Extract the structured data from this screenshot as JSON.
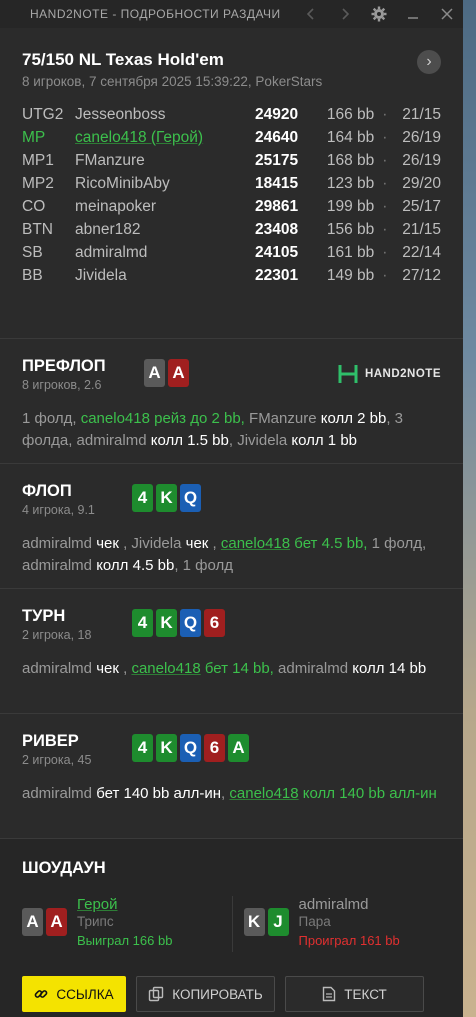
{
  "window": {
    "title": "HAND2NOTE - ПОДРОБНОСТИ РАЗДАЧИ"
  },
  "game": {
    "title": "75/150 NL Texas Hold'em",
    "subtitle": "8 игроков, 7 сентября 2025 15:39:22, PokerStars"
  },
  "players": [
    {
      "pos": "UTG2",
      "name": "Jesseonboss",
      "stack": "24920",
      "bb": "166 bb",
      "sep": "·",
      "stats": "21/15",
      "hero": false
    },
    {
      "pos": "MP",
      "name": "canelo418 (Герой)",
      "stack": "24640",
      "bb": "164 bb",
      "sep": "·",
      "stats": "26/19",
      "hero": true
    },
    {
      "pos": "MP1",
      "name": "FManzure",
      "stack": "25175",
      "bb": "168 bb",
      "sep": "·",
      "stats": "26/19",
      "hero": false
    },
    {
      "pos": "MP2",
      "name": "RicoMinibAby",
      "stack": "18415",
      "bb": "123 bb",
      "sep": "·",
      "stats": "29/20",
      "hero": false
    },
    {
      "pos": "CO",
      "name": "meinapoker",
      "stack": "29861",
      "bb": "199 bb",
      "sep": "·",
      "stats": "25/17",
      "hero": false
    },
    {
      "pos": "BTN",
      "name": "abner182",
      "stack": "23408",
      "bb": "156 bb",
      "sep": "·",
      "stats": "21/15",
      "hero": false
    },
    {
      "pos": "SB",
      "name": "admiralmd",
      "stack": "24105",
      "bb": "161 bb",
      "sep": "·",
      "stats": "22/14",
      "hero": false
    },
    {
      "pos": "BB",
      "name": "Jividela",
      "stack": "22301",
      "bb": "149 bb",
      "sep": "·",
      "stats": "27/12",
      "hero": false
    }
  ],
  "logo": {
    "text": "HAND2NOTE"
  },
  "preflop": {
    "title": "ПРЕФЛОП",
    "sub": "8 игроков, 2.6",
    "cards": [
      {
        "r": "A",
        "c": "#5a5a5a"
      },
      {
        "r": "A",
        "c": "#a01f1f"
      }
    ],
    "t": [
      "1 фолд, ",
      "canelo418 рейз до 2 bb,",
      " FManzure ",
      "колл 2 bb",
      ", 3 фолда, admiralmd ",
      "колл 1.5 bb",
      ", Jividela ",
      "колл 1 bb"
    ]
  },
  "flop": {
    "title": "ФЛОП",
    "sub": "4 игрока, 9.1",
    "cards": [
      {
        "r": "4",
        "c": "#1e8c2e"
      },
      {
        "r": "K",
        "c": "#1e8c2e"
      },
      {
        "r": "Q",
        "c": "#1b5fb4"
      }
    ],
    "t": [
      "admiralmd ",
      "чек",
      " , Jividela ",
      "чек",
      " , ",
      "canelo418",
      " бет 4.5 bb,",
      " 1 фолд, admiralmd ",
      "колл 4.5 bb",
      ", 1 фолд"
    ]
  },
  "turn": {
    "title": "ТУРН",
    "sub": "2 игрока, 18",
    "cards": [
      {
        "r": "4",
        "c": "#1e8c2e"
      },
      {
        "r": "K",
        "c": "#1e8c2e"
      },
      {
        "r": "Q",
        "c": "#1b5fb4"
      },
      {
        "r": "6",
        "c": "#a01f1f"
      }
    ],
    "t": [
      "admiralmd ",
      "чек",
      " , ",
      "canelo418",
      " бет 14 bb,",
      " admiralmd ",
      "колл 14 bb"
    ]
  },
  "river": {
    "title": "РИВЕР",
    "sub": "2 игрока, 45",
    "cards": [
      {
        "r": "4",
        "c": "#1e8c2e"
      },
      {
        "r": "K",
        "c": "#1e8c2e"
      },
      {
        "r": "Q",
        "c": "#1b5fb4"
      },
      {
        "r": "6",
        "c": "#a01f1f"
      },
      {
        "r": "A",
        "c": "#1e8c2e"
      }
    ],
    "t": [
      "admiralmd ",
      "бет 140 bb алл-ин",
      ", ",
      "canelo418",
      " колл 140 bb алл-ин"
    ]
  },
  "showdown": {
    "title": "ШОУДАУН",
    "p1": {
      "cards": [
        {
          "r": "A",
          "c": "#5a5a5a"
        },
        {
          "r": "A",
          "c": "#a01f1f"
        }
      ],
      "name": "Герой",
      "hand": "Трипс",
      "result": "Выиграл 166 bb"
    },
    "p2": {
      "cards": [
        {
          "r": "K",
          "c": "#5a5a5a"
        },
        {
          "r": "J",
          "c": "#1e8c2e"
        }
      ],
      "name": "admiralmd",
      "hand": "Пара",
      "result": "Проиграл 161 bb"
    }
  },
  "buttons": {
    "link": "ССЫЛКА",
    "copy": "КОПИРОВАТЬ",
    "text": "ТЕКСТ"
  },
  "colors": {
    "accent_yellow": "#f4e300",
    "green": "#3cc04c",
    "red": "#e03030",
    "bg": "#2b2b2b"
  },
  "icons": {
    "prev": "chevron-left-icon",
    "next": "chevron-right-icon",
    "settings": "gear-icon",
    "minimize": "minimize-icon",
    "close": "close-icon",
    "open": "chevron-right-icon",
    "link": "link-icon",
    "copy": "copy-icon",
    "text": "document-icon"
  }
}
